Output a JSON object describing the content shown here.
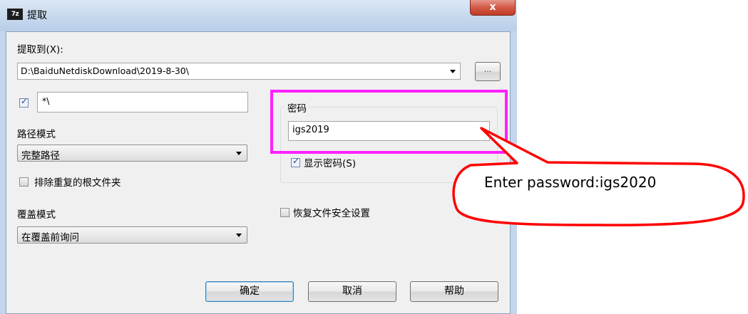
{
  "window": {
    "logo": "7z",
    "title": "提取",
    "close": "x"
  },
  "extract_to": {
    "label": "提取到(X):",
    "path": "D:\\BaiduNetdiskDownload\\2019-8-30\\",
    "browse": "..."
  },
  "filter": {
    "checked": true,
    "value": "*\\"
  },
  "path_mode": {
    "label": "路径模式",
    "selected": "完整路径"
  },
  "exclude_root": {
    "label": "排除重复的根文件夹",
    "checked": false
  },
  "overwrite_mode": {
    "label": "覆盖模式",
    "selected": "在覆盖前询问"
  },
  "password": {
    "group_label": "密码",
    "value": "igs2019",
    "show_label": "显示密码(S)",
    "show_checked": true
  },
  "restore_security": {
    "label": "恢复文件安全设置",
    "checked": false
  },
  "buttons": {
    "ok": "确定",
    "cancel": "取消",
    "help": "帮助"
  },
  "annotation": {
    "callout": "Enter password:igs2020",
    "highlight_color": "#ff20ff",
    "callout_color": "#ff0000"
  }
}
